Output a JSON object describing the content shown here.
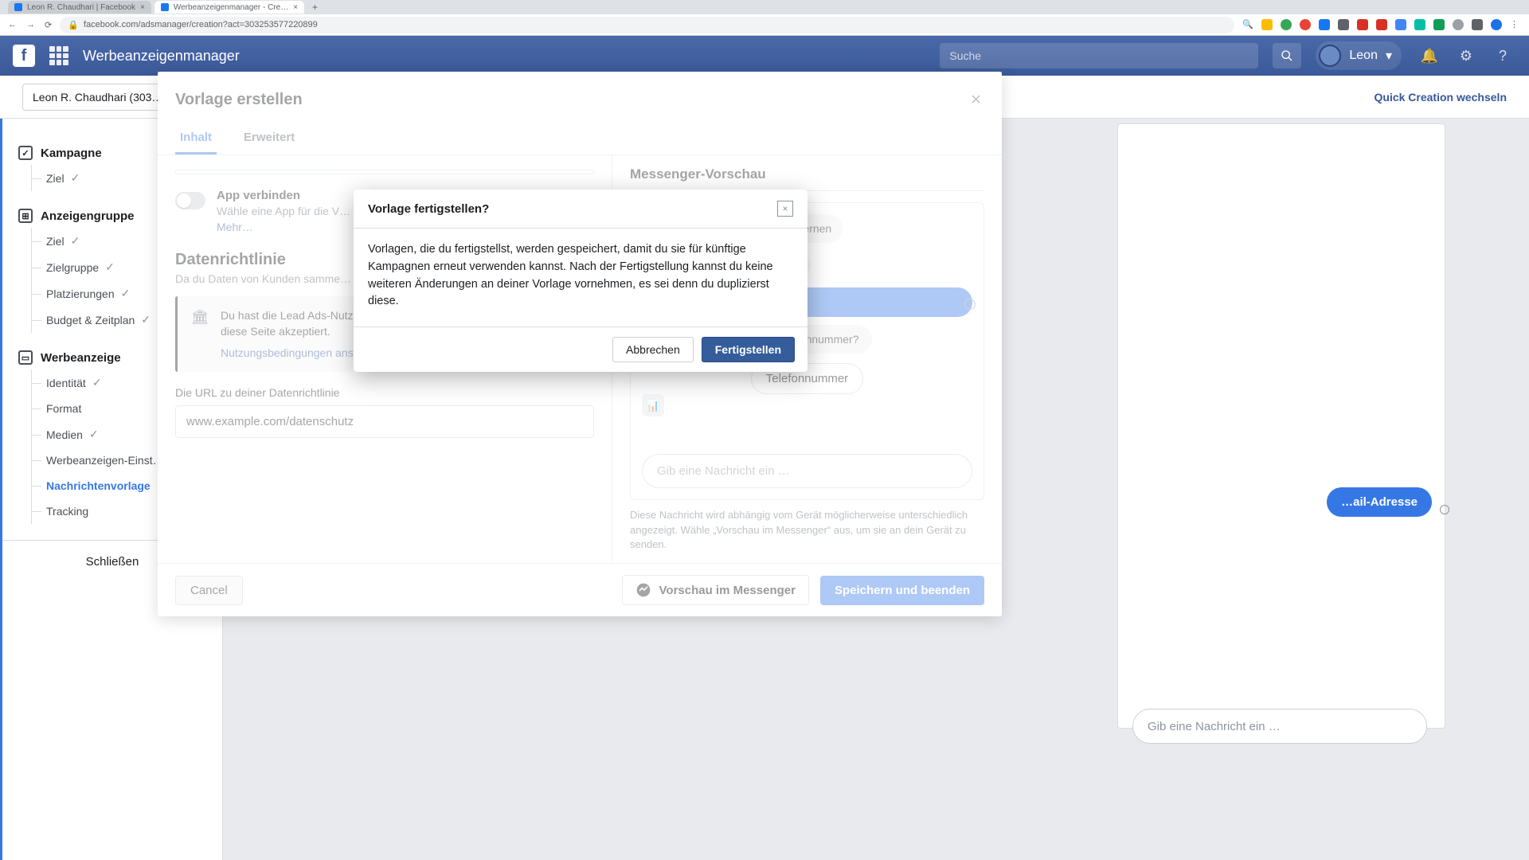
{
  "browser": {
    "tabs": [
      {
        "title": "Leon R. Chaudhari | Facebook"
      },
      {
        "title": "Werbeanzeigenmanager - Cre…"
      }
    ],
    "url": "facebook.com/adsmanager/creation?act=303253577220899"
  },
  "header": {
    "title": "Werbeanzeigenmanager",
    "search_placeholder": "Suche",
    "user": "Leon"
  },
  "subheader": {
    "account": "Leon R. Chaudhari (303…",
    "quick_create": "Quick Creation wechseln"
  },
  "sidebar": {
    "campaign": {
      "label": "Kampagne",
      "items": [
        "Ziel"
      ]
    },
    "adset": {
      "label": "Anzeigengruppe",
      "items": [
        "Ziel",
        "Zielgruppe",
        "Platzierungen",
        "Budget & Zeitplan"
      ]
    },
    "ad": {
      "label": "Werbeanzeige",
      "items": [
        "Identität",
        "Format",
        "Medien",
        "Werbeanzeigen-Einst…",
        "Nachrichtenvorlage",
        "Tracking"
      ]
    },
    "close": "Schließen"
  },
  "modal1": {
    "title": "Vorlage erstellen",
    "tabs": {
      "content": "Inhalt",
      "advanced": "Erweitert"
    },
    "app": {
      "title": "App verbinden",
      "desc_prefix": "Wähle eine App für die V… Interessenten die Fragen… beantwortet haben. ",
      "link": "Mehr…"
    },
    "privacy": {
      "heading": "Datenrichtlinie",
      "desc": "Da du Daten von Kunden samme… deines Unternehmens hinzufüge…"
    },
    "notice": {
      "text": "Du hast die Lead Ads-Nutzungsbedingungen von Facebook für diese Seite akzeptiert.",
      "link": "Nutzungsbedingungen ansehen"
    },
    "url_label": "Die URL zu deiner Datenrichtlinie",
    "url_value": "www.example.com/datenschutz",
    "cancel": "Cancel",
    "preview_btn": "Vorschau im Messenger",
    "save_btn": "Speichern und beenden",
    "preview_title": "Messenger-Vorschau",
    "bubble1": "… dich besser kennenlernen",
    "bubble2": "… E-…",
    "chip_email": "E-Mail-Adresse",
    "bubble_phone": "Wie lautet deine Telefonnummer?",
    "chip_phone": "Telefonnummer",
    "msg_placeholder": "Gib eine Nachricht ein …",
    "preview_note": "Diese Nachricht wird abhängig vom Gerät möglicherweise unterschiedlich angezeigt. Wähle „Vorschau im Messenger“ aus, um sie an dein Gerät zu senden."
  },
  "modal2": {
    "title": "Vorlage fertigstellen?",
    "body": "Vorlagen, die du fertigstellst, werden gespeichert, damit du sie für künftige Kampagnen erneut verwenden kannst. Nach der Fertigstellung kannst du keine weiteren Änderungen an deiner Vorlage vornehmen, es sei denn du duplizierst diese.",
    "cancel": "Abbrechen",
    "confirm": "Fertigstellen"
  },
  "background_page": {
    "pill": "…ail-Adresse",
    "input": "Gib eine Nachricht ein …"
  }
}
